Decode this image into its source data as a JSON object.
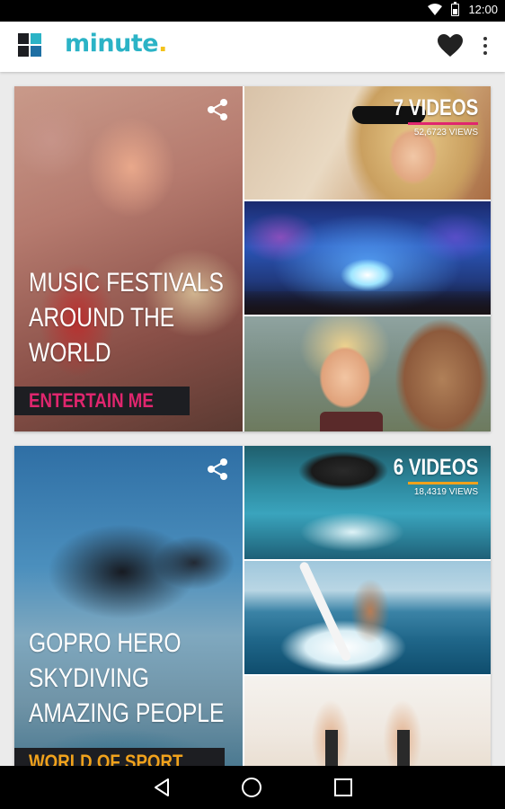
{
  "status_bar": {
    "time": "12:00"
  },
  "app": {
    "logo_text": "minute",
    "logo_dot": ".",
    "logo_colors": [
      "#2bb3c6",
      "#1e6fa3",
      "#1d1e22",
      "#2a2a2a"
    ],
    "icons": {
      "favorites": "heart-icon",
      "menu": "more-vert-icon"
    }
  },
  "cards": [
    {
      "title_lines": [
        "MUSIC FESTIVALS",
        "AROUND THE",
        "WORLD"
      ],
      "category": "ENTERTAIN ME",
      "category_color": "#e0266e",
      "video_count": "7 VIDEOS",
      "views": "52,6723 VIEWS",
      "accent_color": "#e0266e",
      "share_icon": "share-icon"
    },
    {
      "title_lines": [
        "GOPRO HERO",
        "SKYDIVING",
        "AMAZING PEOPLE"
      ],
      "category": "WORLD OF SPORT",
      "category_color": "#f0a21c",
      "video_count": "6 VIDEOS",
      "views": "18,4319 VIEWS",
      "accent_color": "#f0a21c",
      "share_icon": "share-icon"
    }
  ],
  "nav_bar": {
    "back": "back-icon",
    "home": "home-icon",
    "recents": "recents-icon"
  }
}
